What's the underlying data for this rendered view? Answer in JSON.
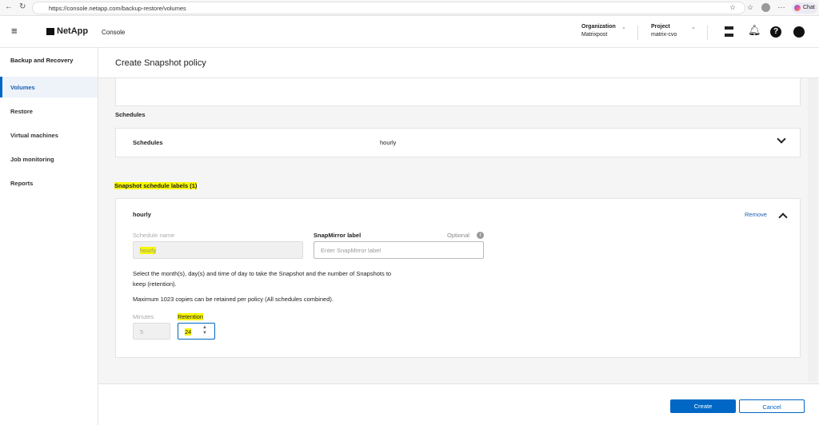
{
  "browser": {
    "url": "https://console.netapp.com/backup-restore/volumes",
    "chat": "Chat"
  },
  "header": {
    "brand": "NetApp",
    "app": "Console",
    "org_label": "Organization",
    "org_value": "Matrixpost",
    "project_label": "Project",
    "project_value": "matrix-cvo"
  },
  "sidebar": {
    "title": "Backup and Recovery",
    "items": [
      {
        "label": "Volumes"
      },
      {
        "label": "Restore"
      },
      {
        "label": "Virtual machines"
      },
      {
        "label": "Job monitoring"
      },
      {
        "label": "Reports"
      }
    ]
  },
  "page": {
    "title": "Create Snapshot policy",
    "schedules_heading": "Schedules",
    "schedules_row": {
      "label": "Schedules",
      "value": "hourly"
    },
    "labels_heading": "Snapshot schedule labels (1)",
    "label_card": {
      "name": "hourly",
      "remove": "Remove",
      "schedule_name_label": "Schedule name",
      "schedule_name_value": "hourly",
      "snapmirror_label": "SnapMirror label",
      "optional": "Optional",
      "snapmirror_placeholder": "Enter SnapMirror label",
      "help1": "Select the month(s), day(s) and time of day to take the Snapshot and the number of Snapshots to keep (retention).",
      "help2": "Maximum 1023 copies can be retained per policy (All schedules combined).",
      "minutes_label": "Minutes",
      "minutes_value": "5",
      "retention_label": "Retention",
      "retention_value": "24"
    }
  },
  "footer": {
    "create": "Create",
    "cancel": "Cancel"
  }
}
